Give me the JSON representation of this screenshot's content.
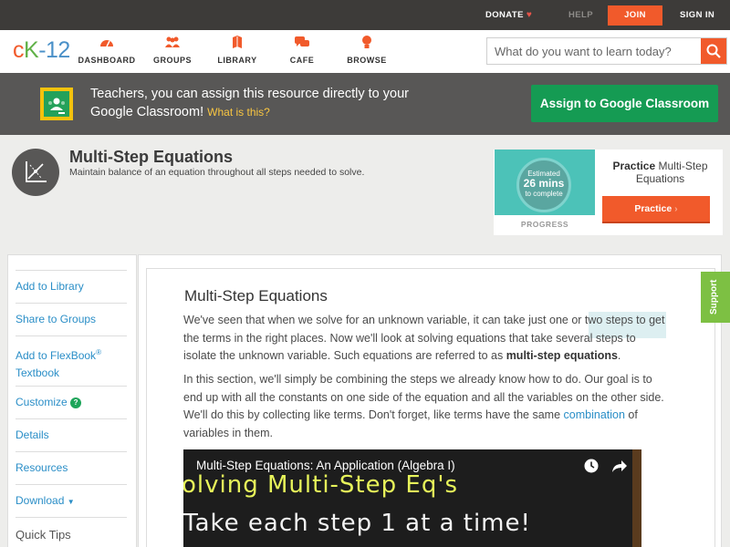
{
  "topbar": {
    "donate": "DONATE",
    "help": "HELP",
    "join": "JOIN",
    "signin": "SIGN IN"
  },
  "logo": {
    "c": "c",
    "k": "K",
    "n": "-12"
  },
  "nav": {
    "items": [
      {
        "label": "DASHBOARD",
        "icon": "dashboard-icon"
      },
      {
        "label": "GROUPS",
        "icon": "groups-icon"
      },
      {
        "label": "LIBRARY",
        "icon": "library-icon"
      },
      {
        "label": "CAFE",
        "icon": "cafe-icon"
      },
      {
        "label": "BROWSE",
        "icon": "browse-icon"
      }
    ],
    "search_placeholder": "What do you want to learn today?"
  },
  "banner": {
    "text": "Teachers, you can assign this resource directly to your Google Classroom!",
    "what": "What is this?",
    "button": "Assign to Google Classroom"
  },
  "concept": {
    "title": "Multi-Step Equations",
    "description": "Maintain balance of an equation throughout all steps needed to solve."
  },
  "practice": {
    "estimated": "Estimated",
    "mins": "26 mins",
    "to_complete": "to complete",
    "progress": "PROGRESS",
    "title_bold": "Practice",
    "title_rest": "Multi-Step Equations",
    "button": "Practice"
  },
  "sidebar": {
    "add_library": "Add to Library",
    "share_groups": "Share to Groups",
    "add_flexbook": "Add to FlexBook",
    "reg": "®",
    "textbook": "Textbook",
    "customize": "Customize",
    "details": "Details",
    "resources": "Resources",
    "download": "Download",
    "quick_tips": "Quick Tips"
  },
  "article": {
    "title": "Multi-Step Equations",
    "p1_a": "We've seen that when we solve for an unknown variable, it can take just one or two steps to get the terms in the right places. Now we'll look at solving equations that take several steps to isolate the unknown variable. Such equations are referred to as ",
    "p1_b": "multi-step equations",
    "p1_c": ".",
    "p2_a": "In this section, we'll simply be combining the steps we already know how to do. Our goal is to end up with all the constants on one side of the equation and all the variables on the other side. We'll do this by collecting like terms. Don't forget, like terms have the same ",
    "p2_link": "combination",
    "p2_c": " of variables in them."
  },
  "video": {
    "title": "Multi-Step Equations: An Application (Algebra I)",
    "board_line1": "olving Multi-Step Eq's",
    "board_line2": "Take each step 1 at a time!"
  },
  "support": "Support"
}
